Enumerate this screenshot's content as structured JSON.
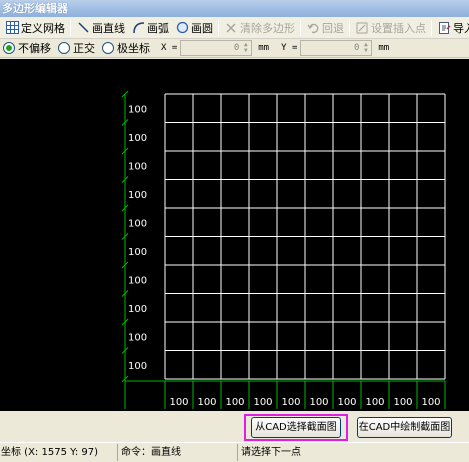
{
  "window": {
    "title": "多边形编辑器"
  },
  "toolbar": {
    "define_grid": "定义网格",
    "draw_line": "画直线",
    "draw_arc": "画弧",
    "draw_circle": "画圆",
    "clear_polygon": "清除多边形",
    "undo": "回退",
    "set_insert_point": "设置插入点",
    "import": "导入"
  },
  "options": {
    "no_offset": "不偏移",
    "orthogonal": "正交",
    "polar": "极坐标",
    "selected": "不偏移",
    "x_label": "X =",
    "x_value": "0",
    "x_unit": "mm",
    "y_label": "Y =",
    "y_value": "0",
    "y_unit": "mm"
  },
  "grid": {
    "rows": 10,
    "cols": 10,
    "row_labels": [
      "100",
      "100",
      "100",
      "100",
      "100",
      "100",
      "100",
      "100",
      "100",
      "100"
    ],
    "col_labels": [
      "100",
      "100",
      "100",
      "100",
      "100",
      "100",
      "100",
      "100",
      "100",
      "100"
    ],
    "colors": {
      "background": "#000000",
      "grid_line": "#ffffff",
      "axis": "#00b800",
      "label": "#ffffff"
    }
  },
  "buttons": {
    "select_from_cad": "从CAD选择截面图",
    "draw_in_cad": "在CAD中绘制截面图",
    "highlight_color": "#e21ee2"
  },
  "status": {
    "coords": "坐标 (X: 1575 Y: 97)",
    "command": "命令：画直线",
    "prompt": "请选择下一点"
  }
}
